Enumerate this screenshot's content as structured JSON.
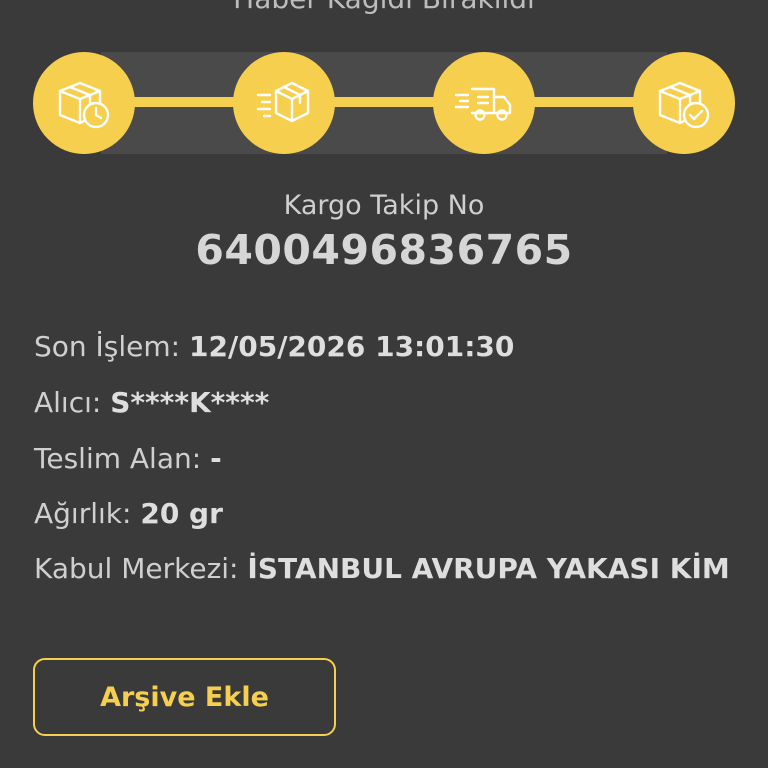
{
  "header": {
    "status_title": "Haber Kağıdı Bırakıldı"
  },
  "progress": {
    "steps": [
      {
        "icon": "package-clock-icon"
      },
      {
        "icon": "package-moving-icon"
      },
      {
        "icon": "delivery-truck-icon"
      },
      {
        "icon": "package-check-icon"
      }
    ],
    "accent_color": "#f7cf4e"
  },
  "tracking": {
    "label": "Kargo Takip No",
    "number": "6400496836765"
  },
  "details": {
    "last_action_label": "Son İşlem:",
    "last_action_value": "12/05/2026 13:01:30",
    "recipient_label": "Alıcı:",
    "recipient_value": "S****K****",
    "delivered_to_label": "Teslim Alan:",
    "delivered_to_value": "-",
    "weight_label": "Ağırlık:",
    "weight_value": "20 gr",
    "acceptance_center_label": "Kabul Merkezi:",
    "acceptance_center_value": "İSTANBUL AVRUPA YAKASI KİM"
  },
  "actions": {
    "archive_label": "Arşive Ekle"
  }
}
